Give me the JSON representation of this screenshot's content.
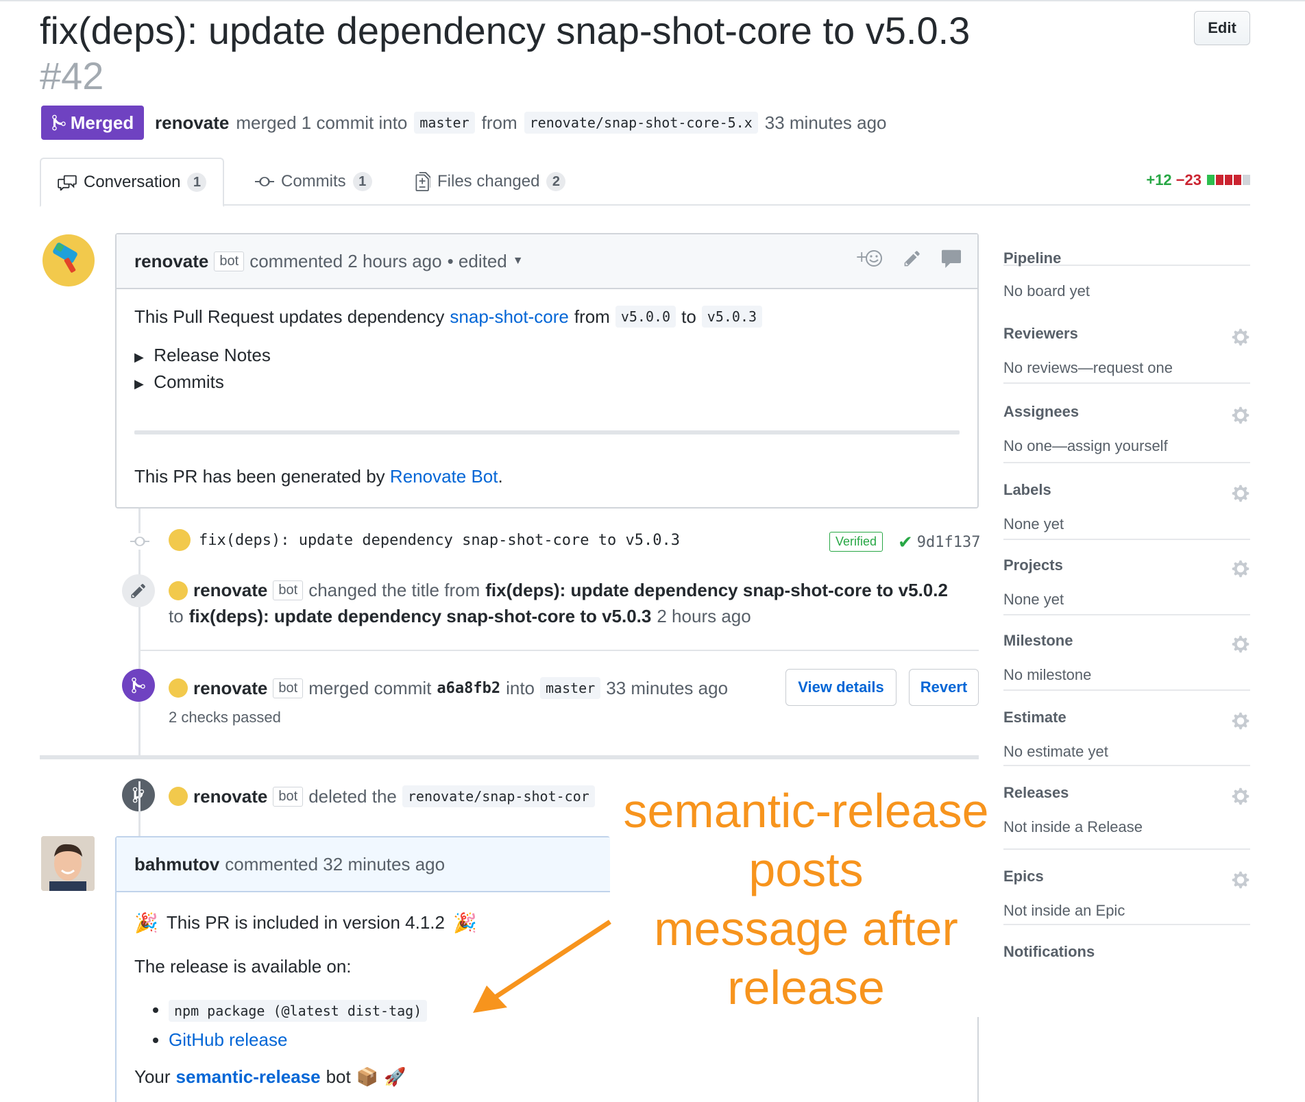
{
  "header": {
    "title": "fix(deps): update dependency snap-shot-core to v5.0.3",
    "number": "#42",
    "edit_label": "Edit",
    "state_label": "Merged",
    "author": "renovate",
    "merged_text": "merged 1 commit into",
    "base_branch": "master",
    "from_text": "from",
    "head_branch": "renovate/snap-shot-core-5.x",
    "time": "33 minutes ago"
  },
  "tabs": [
    {
      "label": "Conversation",
      "count": "1",
      "icon": "comment-discussion-icon"
    },
    {
      "label": "Commits",
      "count": "1",
      "icon": "git-commit-icon"
    },
    {
      "label": "Files changed",
      "count": "2",
      "icon": "diff-icon"
    }
  ],
  "diffstat": {
    "additions": "+12",
    "deletions": "−23",
    "colors": [
      "#2cbe4e",
      "#cb2431",
      "#cb2431",
      "#cb2431",
      "#d1d5da"
    ]
  },
  "comment": {
    "author": "renovate",
    "bot_tag": "bot",
    "action": "commented 2 hours ago",
    "edited": "• edited",
    "body_prefix": "This Pull Request updates dependency",
    "package_link": "snap-shot-core",
    "from_word": "from",
    "from_version": "v5.0.0",
    "to_word": "to",
    "to_version": "v5.0.3",
    "details": [
      "Release Notes",
      "Commits"
    ],
    "footer_prefix": "This PR has been generated by",
    "footer_link": "Renovate Bot",
    "footer_suffix": "."
  },
  "timeline": {
    "commit_message": "fix(deps): update dependency snap-shot-core to v5.0.3",
    "verified_label": "Verified",
    "commit_sha": "9d1f137",
    "rename": {
      "author": "renovate",
      "bot_tag": "bot",
      "action": "changed the title from",
      "old_title": "fix(deps): update dependency snap-shot-core to v5.0.2",
      "to_word": "to",
      "new_title": "fix(deps): update dependency snap-shot-core to v5.0.3",
      "time": "2 hours ago"
    },
    "merge": {
      "author": "renovate",
      "bot_tag": "bot",
      "action": "merged commit",
      "sha": "a6a8fb2",
      "into": "into",
      "branch": "master",
      "time": "33 minutes ago",
      "checks": "2 checks passed",
      "view_details": "View details",
      "revert": "Revert"
    },
    "delete": {
      "author": "renovate",
      "bot_tag": "bot",
      "action": "deleted the",
      "branch": "renovate/snap-shot-cor"
    }
  },
  "comment2": {
    "author": "bahmutov",
    "action": "commented 32 minutes ago",
    "line1": "This PR is included in version 4.1.2",
    "line2": "The release is available on:",
    "items": [
      "npm package (@latest dist-tag)",
      "GitHub release"
    ],
    "sign_prefix": "Your",
    "sign_link": "semantic-release",
    "sign_suffix": "bot"
  },
  "sidebar": [
    {
      "title": "Pipeline",
      "value": "No board yet",
      "gear": false
    },
    {
      "title": "Reviewers",
      "value": "No reviews—request one",
      "gear": true
    },
    {
      "title": "Assignees",
      "value": "No one—assign yourself",
      "gear": true
    },
    {
      "title": "Labels",
      "value": "None yet",
      "gear": true
    },
    {
      "title": "Projects",
      "value": "None yet",
      "gear": true
    },
    {
      "title": "Milestone",
      "value": "No milestone",
      "gear": true
    },
    {
      "title": "Estimate",
      "value": "No estimate yet",
      "gear": true
    },
    {
      "title": "Releases",
      "value": "Not inside a Release",
      "gear": true
    },
    {
      "title": "Epics",
      "value": "Not inside an Epic",
      "gear": true
    },
    {
      "title": "Notifications",
      "value": "",
      "gear": false
    }
  ],
  "annotation": {
    "lines": [
      "semantic-release",
      "posts",
      "message after",
      "release"
    ],
    "color": "#f7941d"
  },
  "colors": {
    "merged": "#6f42c1",
    "link": "#0366d6",
    "verified": "#28a745"
  }
}
